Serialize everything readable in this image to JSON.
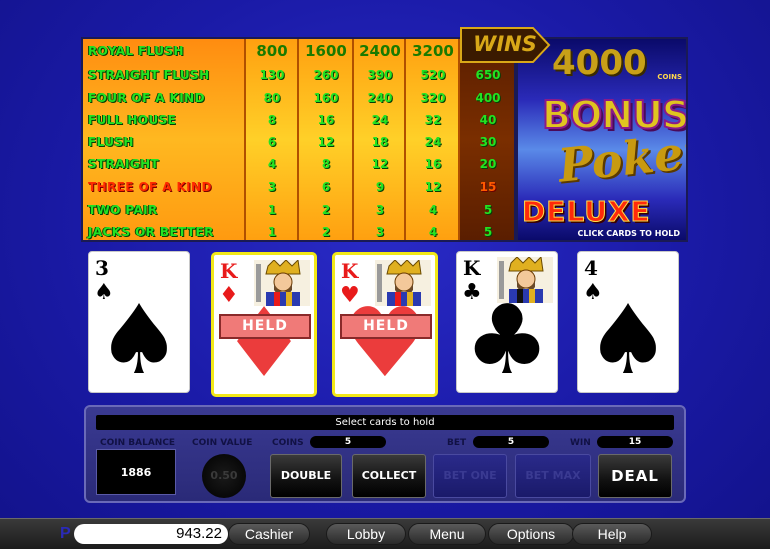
{
  "paytable": {
    "rows": [
      {
        "hand": "ROYAL FLUSH",
        "pays": [
          "800",
          "1600",
          "2400",
          "3200"
        ],
        "win": "4000",
        "highlight": false
      },
      {
        "hand": "STRAIGHT FLUSH",
        "pays": [
          "130",
          "260",
          "390",
          "520"
        ],
        "win": "650",
        "highlight": false
      },
      {
        "hand": "FOUR OF A KIND",
        "pays": [
          "80",
          "160",
          "240",
          "320"
        ],
        "win": "400",
        "highlight": false
      },
      {
        "hand": "FULL HOUSE",
        "pays": [
          "8",
          "16",
          "24",
          "32"
        ],
        "win": "40",
        "highlight": false
      },
      {
        "hand": "FLUSH",
        "pays": [
          "6",
          "12",
          "18",
          "24"
        ],
        "win": "30",
        "highlight": false
      },
      {
        "hand": "STRAIGHT",
        "pays": [
          "4",
          "8",
          "12",
          "16"
        ],
        "win": "20",
        "highlight": false
      },
      {
        "hand": "THREE OF A KIND",
        "pays": [
          "3",
          "6",
          "9",
          "12"
        ],
        "win": "15",
        "highlight": true
      },
      {
        "hand": "TWO PAIR",
        "pays": [
          "1",
          "2",
          "3",
          "4"
        ],
        "win": "5",
        "highlight": false
      },
      {
        "hand": "JACKS OR BETTER",
        "pays": [
          "1",
          "2",
          "3",
          "4"
        ],
        "win": "5",
        "highlight": false
      }
    ],
    "wins_label": "WINS",
    "jackpot_amount": "4000",
    "jackpot_unit": "COINS"
  },
  "logo": {
    "line1": "BONUS",
    "line2": "Poker",
    "line3": "DELUXE",
    "hint": "CLICK CARDS TO HOLD"
  },
  "cards": [
    {
      "rank": "3",
      "suit": "♠",
      "color": "black",
      "face": false,
      "held": false,
      "held_label": ""
    },
    {
      "rank": "K",
      "suit": "♦",
      "color": "red",
      "face": true,
      "held": true,
      "held_label": "HELD"
    },
    {
      "rank": "K",
      "suit": "♥",
      "color": "red",
      "face": true,
      "held": true,
      "held_label": "HELD"
    },
    {
      "rank": "K",
      "suit": "♣",
      "color": "black",
      "face": true,
      "held": false,
      "held_label": ""
    },
    {
      "rank": "4",
      "suit": "♠",
      "color": "black",
      "face": false,
      "held": false,
      "held_label": ""
    }
  ],
  "controls": {
    "message": "Select cards to hold",
    "coin_balance_label": "COIN BALANCE",
    "coin_balance": "1886",
    "coin_value_label": "COIN VALUE",
    "coin_value": "0.50",
    "coins_label": "COINS",
    "coins": "5",
    "bet_label": "BET",
    "bet": "5",
    "win_label": "WIN",
    "win": "15",
    "double_label": "DOUBLE",
    "collect_label": "COLLECT",
    "bet_one_label": "BET ONE",
    "bet_max_label": "BET MAX",
    "deal_label": "DEAL"
  },
  "bottom_bar": {
    "p_letter": "P",
    "balance": "943.22",
    "cashier_label": "Cashier",
    "lobby_label": "Lobby",
    "menu_label": "Menu",
    "options_label": "Options",
    "help_label": "Help"
  },
  "colors": {
    "held_border": "#f2e818",
    "held_bar": "#f07a78",
    "paytable_text": "#22e322",
    "highlight_text": "#ff2a00",
    "background": "#1a1aa6"
  }
}
